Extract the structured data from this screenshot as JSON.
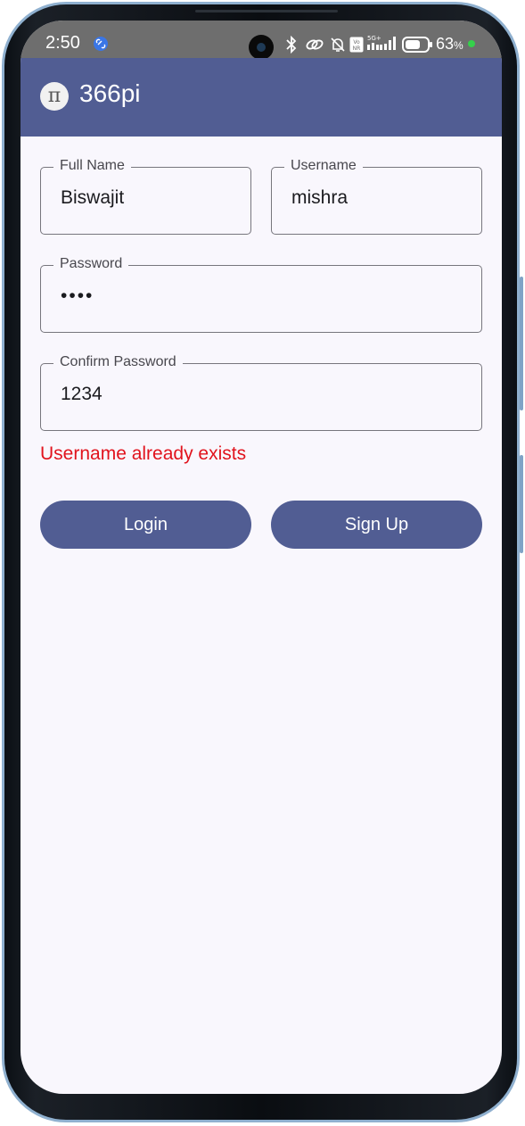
{
  "status_bar": {
    "time": "2:50",
    "battery_percent": "63",
    "battery_unit": "%",
    "network_label": "5G+",
    "icons": [
      "link-icon",
      "camera-icon",
      "bluetooth-icon",
      "link-icon",
      "silent-bell-icon",
      "volte-icon",
      "signal-icon",
      "battery-icon"
    ]
  },
  "app_bar": {
    "title": "366pi",
    "logo_glyph": "π"
  },
  "form": {
    "full_name": {
      "label": "Full Name",
      "value": "Biswajit"
    },
    "username": {
      "label": "Username",
      "value": "mishra"
    },
    "password": {
      "label": "Password",
      "value": "••••"
    },
    "confirm_password": {
      "label": "Confirm Password",
      "value": "1234"
    },
    "error": "Username already exists"
  },
  "buttons": {
    "login": "Login",
    "signup": "Sign Up"
  },
  "colors": {
    "primary": "#515d93",
    "error": "#e1131d",
    "background": "#f9f7fd"
  }
}
